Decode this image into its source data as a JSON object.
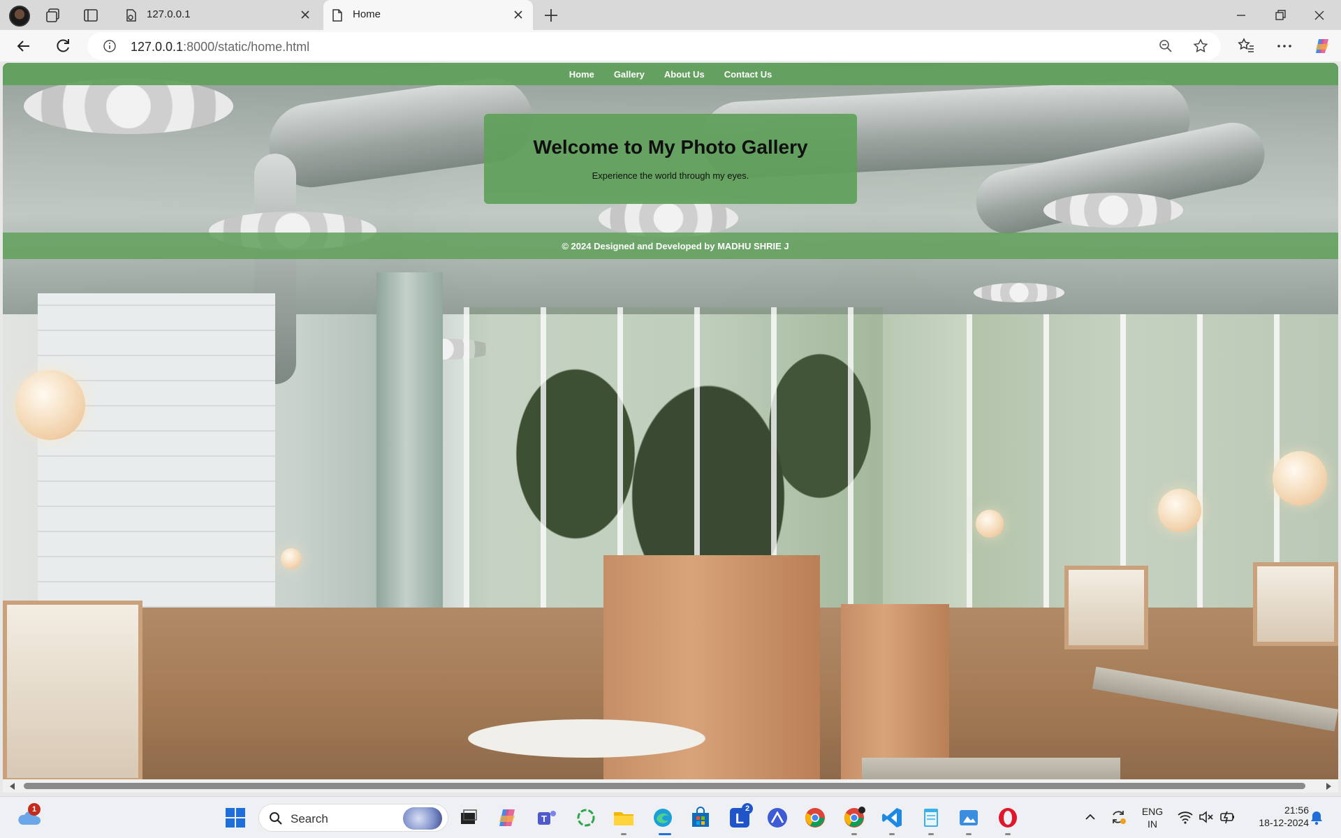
{
  "browser": {
    "tabs": [
      {
        "title": "127.0.0.1",
        "active": false
      },
      {
        "title": "Home",
        "active": true
      }
    ],
    "address_bar": {
      "host": "127.0.0.1",
      "path": ":8000/static/home.html"
    }
  },
  "page": {
    "nav": {
      "items": [
        "Home",
        "Gallery",
        "About Us",
        "Contact Us"
      ]
    },
    "hero": {
      "title": "Welcome to My Photo Gallery",
      "subtitle": "Experience the world through my eyes."
    },
    "footer": {
      "text": "© 2024 Designed and Developed by MADHU SHRIE J"
    },
    "accent_color": "#60a05a"
  },
  "taskbar": {
    "search_label": "Search",
    "weather_badge": "1",
    "app_badge": "2",
    "language": {
      "line1": "ENG",
      "line2": "IN"
    },
    "clock": {
      "time": "21:56",
      "date": "18-12-2024"
    }
  }
}
